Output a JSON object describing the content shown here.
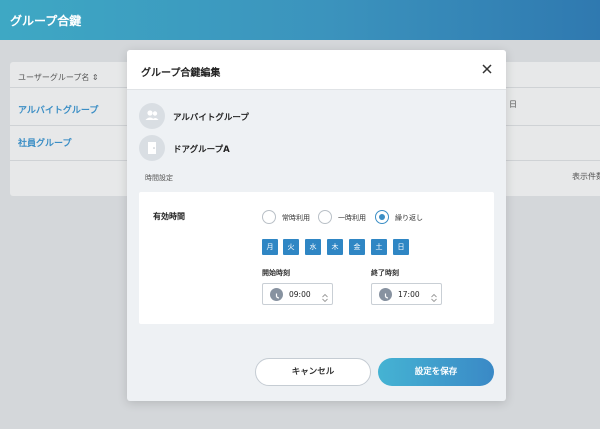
{
  "app": {
    "title": "グループ合鍵"
  },
  "background": {
    "column_header": "ユーザーグループ名 ⇕",
    "rows": [
      "アルバイトグループ",
      "社員グループ"
    ],
    "right_cell": "日",
    "footer_text": "表示件数"
  },
  "modal": {
    "title": "グループ合鍵編集",
    "members": [
      {
        "name": "アルバイトグループ",
        "icon": "users-icon"
      },
      {
        "name": "ドアグループA",
        "icon": "door-icon"
      }
    ],
    "section_label": "時間設定",
    "validity": {
      "label": "有効時間",
      "options": [
        "常時利用",
        "一時利用",
        "繰り返し"
      ],
      "selected": "繰り返し",
      "days": [
        "月",
        "火",
        "水",
        "木",
        "金",
        "土",
        "日"
      ],
      "start": {
        "label": "開始時刻",
        "value": "09:00"
      },
      "end": {
        "label": "終了時刻",
        "value": "17:00"
      }
    },
    "buttons": {
      "cancel": "キャンセル",
      "save": "設定を保存"
    }
  },
  "colors": {
    "accent": "#3b8ec5",
    "day_button": "#2f86c4",
    "save_gradient_start": "#45b3d3",
    "save_gradient_end": "#3a89c6"
  }
}
